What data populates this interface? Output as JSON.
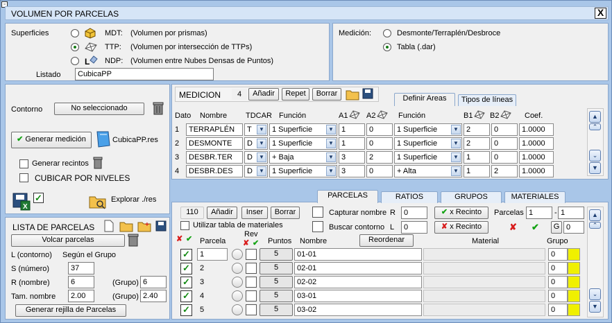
{
  "title": "VOLUMEN POR PARCELAS",
  "close_symbol": "X",
  "superficies": {
    "label": "Superficies",
    "options": [
      {
        "code": "MDT:",
        "desc": "(Volumen por prismas)",
        "selected": false
      },
      {
        "code": "TTP:",
        "desc": "(Volumen por intersección de TTPs)",
        "selected": true
      },
      {
        "code": "NDP:",
        "desc": "(Volumen entre Nubes Densas de Puntos)",
        "selected": false
      }
    ],
    "listado_label": "Listado",
    "listado_value": "CubicaPP"
  },
  "medicion_opts": {
    "label": "Medición:",
    "options": [
      {
        "label": "Desmonte/Terraplén/Desbroce",
        "selected": false
      },
      {
        "label": "Tabla (.dar)",
        "selected": true
      }
    ]
  },
  "contorno": {
    "label": "Contorno",
    "button": "No seleccionado",
    "generar_medicion": "Generar medición",
    "res_file": "CubicaPP.res",
    "generar_recintos": "Generar recintos",
    "cubicar_niveles": "CUBICAR POR NIVELES",
    "explorar": "Explorar ./res"
  },
  "lista_parcelas": {
    "title": "LISTA DE PARCELAS",
    "volcar": "Volcar parcelas",
    "l_label": "L (contorno)",
    "l_value": "Según el Grupo",
    "s_label": "S (número)",
    "s_value": "37",
    "r_label": "R (nombre)",
    "r_value": "6",
    "grupo_label1": "(Grupo)",
    "grupo_value1": "6",
    "tam_label": "Tam. nombre",
    "tam_value": "2.00",
    "grupo_label2": "(Grupo)",
    "grupo_value2": "2.40",
    "generar_rejilla": "Generar rejilla de Parcelas"
  },
  "medicion": {
    "label": "MEDICION",
    "count": "4",
    "btn_anadir": "Añadir",
    "btn_repet": "Repet",
    "btn_borrar": "Borrar",
    "tabs": [
      "Definir Areas",
      "Tipos de líneas"
    ],
    "active_tab": "Definir Areas",
    "headers": {
      "dato": "Dato",
      "nombre": "Nombre",
      "tdcar": "TDCAR",
      "funcion": "Función",
      "a1": "A1",
      "a2": "A2",
      "funcion2": "Función",
      "b1": "B1",
      "b2": "B2",
      "coef": "Coef."
    },
    "rows": [
      {
        "dato": "1",
        "nombre": "TERRAPLÉN",
        "tdcar": "T",
        "funcion": "1 Superficie",
        "a1": "1",
        "a2": "0",
        "funcion2": "1 Superficie",
        "b1": "2",
        "b2": "0",
        "coef": "1.0000"
      },
      {
        "dato": "2",
        "nombre": "DESMONTE",
        "tdcar": "D",
        "funcion": "1 Superficie",
        "a1": "1",
        "a2": "0",
        "funcion2": "1 Superficie",
        "b1": "2",
        "b2": "0",
        "coef": "1.0000"
      },
      {
        "dato": "3",
        "nombre": "DESBR.TER",
        "tdcar": "D",
        "funcion": "+ Baja",
        "a1": "3",
        "a2": "2",
        "funcion2": "1 Superficie",
        "b1": "1",
        "b2": "0",
        "coef": "1.0000"
      },
      {
        "dato": "4",
        "nombre": "DESBR.DES",
        "tdcar": "D",
        "funcion": "1 Superficie",
        "a1": "3",
        "a2": "0",
        "funcion2": "+ Alta",
        "b1": "1",
        "b2": "2",
        "coef": "1.0000"
      }
    ]
  },
  "parcelas": {
    "tabs": [
      "PARCELAS",
      "RATIOS",
      "GRUPOS",
      "MATERIALES"
    ],
    "active_tab": "PARCELAS",
    "count": "110",
    "btn_anadir": "Añadir",
    "btn_inser": "Inser",
    "btn_borrar": "Borrar",
    "usar_tabla": "Utilizar tabla de materiales",
    "capturar": "Capturar nombre",
    "buscar": "Buscar contorno",
    "r_label": "R",
    "r_value": "0",
    "l_label": "L",
    "l_value": "0",
    "x_recinto_ok": "x Recinto",
    "x_recinto_del": "x Recinto",
    "parcelas_label": "Parcelas",
    "parcelas_from": "1",
    "parcelas_dash": "-",
    "parcelas_to": "1",
    "g_label": "G",
    "g_value": "0",
    "headers": {
      "parcela": "Parcela",
      "rev": "Rev",
      "puntos": "Puntos",
      "nombre": "Nombre",
      "reordenar": "Reordenar",
      "material": "Material",
      "grupo": "Grupo"
    },
    "rows": [
      {
        "parcela": "1",
        "puntos": "5",
        "nombre": "01-01",
        "grupo": "0"
      },
      {
        "parcela": "2",
        "puntos": "5",
        "nombre": "02-01",
        "grupo": "0"
      },
      {
        "parcela": "3",
        "puntos": "5",
        "nombre": "02-02",
        "grupo": "0"
      },
      {
        "parcela": "4",
        "puntos": "5",
        "nombre": "03-01",
        "grupo": "0"
      },
      {
        "parcela": "5",
        "puntos": "5",
        "nombre": "03-02",
        "grupo": "0"
      }
    ]
  },
  "colors": {
    "frame": "#a9c6e8",
    "panel": "#f0f0f0",
    "grupo_color": "#f0f000",
    "check_green": "#138a13",
    "x_red": "#d81c1c"
  },
  "icons": [
    "cube-icon",
    "ttp-surface-icon",
    "ndp-points-icon",
    "trash-icon",
    "book-icon",
    "save-excel-icon",
    "folder-icon",
    "new-doc-icon",
    "open-folder-icon",
    "save-icon",
    "surface-diagram-icon"
  ]
}
